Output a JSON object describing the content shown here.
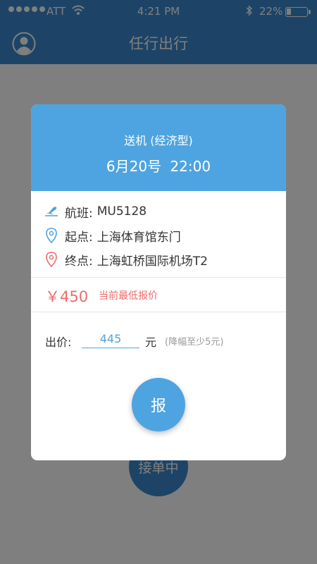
{
  "status_bar": {
    "carrier": "ATT",
    "time": "4:21 PM",
    "battery": "22%",
    "battery_level": 0.22,
    "signal_icon": "signal-dots-icon",
    "wifi_icon": "wifi-icon",
    "bluetooth_icon": "bluetooth-icon"
  },
  "nav": {
    "title": "任行出行",
    "avatar_icon": "user-avatar-icon"
  },
  "background": {
    "button_label": "接单中"
  },
  "modal": {
    "trip_type": "送机 (经济型)",
    "datetime": "6月20号  22:00",
    "flight_label": "航班:",
    "flight_value": "MU5128",
    "origin_label": "起点:",
    "origin_value": "上海体育馆东门",
    "destination_label": "终点:",
    "destination_value": "上海虹桥国际机场T2",
    "lowest_price": "￥450",
    "lowest_price_note": "当前最低报价",
    "bid_label": "出价:",
    "bid_value": "445",
    "bid_unit": "元",
    "bid_hint": "(降幅至少5元)",
    "submit_label": "报"
  },
  "colors": {
    "primary": "#3b88cc",
    "header": "#4ea4e0",
    "price_red": "#ee6b6b"
  }
}
